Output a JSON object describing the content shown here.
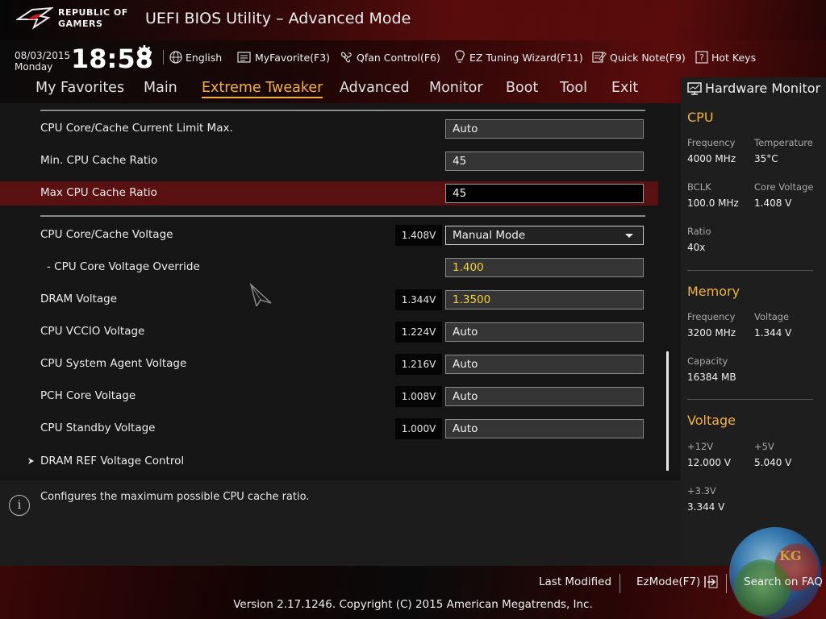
{
  "header": {
    "brand_line1": "REPUBLIC OF",
    "brand_line2": "GAMERS",
    "title": "UEFI BIOS Utility – Advanced Mode",
    "date": "08/03/2015",
    "day": "Monday",
    "time": "18:58"
  },
  "toolbar": {
    "language": "English",
    "my_favorite": "MyFavorite(F3)",
    "qfan": "Qfan Control(F6)",
    "ez_tuning": "EZ Tuning Wizard(F11)",
    "quick_note": "Quick Note(F9)",
    "hot_keys": "Hot Keys"
  },
  "tabs": [
    {
      "label": "My Favorites"
    },
    {
      "label": "Main"
    },
    {
      "label": "Extreme Tweaker",
      "active": true
    },
    {
      "label": "Advanced"
    },
    {
      "label": "Monitor"
    },
    {
      "label": "Boot"
    },
    {
      "label": "Tool"
    },
    {
      "label": "Exit"
    }
  ],
  "settings": [
    {
      "label": "CPU Core/Cache Current Limit Max.",
      "value": "Auto"
    },
    {
      "label": "Min. CPU Cache Ratio",
      "value": "45"
    },
    {
      "label": "Max CPU Cache Ratio",
      "value": "45",
      "selected": true
    },
    {
      "label": "CPU Core/Cache Voltage",
      "reading": "1.408V",
      "value": "Manual Mode",
      "type": "dropdown"
    },
    {
      "label": "- CPU Core Voltage Override",
      "value": "1.400"
    },
    {
      "label": "DRAM Voltage",
      "reading": "1.344V",
      "value": "1.3500"
    },
    {
      "label": "CPU VCCIO Voltage",
      "reading": "1.224V",
      "value": "Auto"
    },
    {
      "label": "CPU System Agent Voltage",
      "reading": "1.216V",
      "value": "Auto"
    },
    {
      "label": "PCH Core Voltage",
      "reading": "1.008V",
      "value": "Auto"
    },
    {
      "label": "CPU Standby Voltage",
      "reading": "1.000V",
      "value": "Auto"
    },
    {
      "label": "DRAM REF Voltage Control",
      "type": "submenu"
    }
  ],
  "info": {
    "icon": "i",
    "text": "Configures the maximum possible CPU cache ratio."
  },
  "hw_monitor": {
    "title": "Hardware Monitor",
    "cpu": {
      "title": "CPU",
      "frequency_label": "Frequency",
      "frequency": "4000 MHz",
      "temperature_label": "Temperature",
      "temperature": "35°C",
      "bclk_label": "BCLK",
      "bclk": "100.0 MHz",
      "core_voltage_label": "Core Voltage",
      "core_voltage": "1.408 V",
      "ratio_label": "Ratio",
      "ratio": "40x"
    },
    "memory": {
      "title": "Memory",
      "frequency_label": "Frequency",
      "frequency": "3200 MHz",
      "voltage_label": "Voltage",
      "voltage": "1.344 V",
      "capacity_label": "Capacity",
      "capacity": "16384 MB"
    },
    "voltage": {
      "title": "Voltage",
      "v12_label": "+12V",
      "v12": "12.000 V",
      "v5_label": "+5V",
      "v5": "5.040 V",
      "v33_label": "+3.3V",
      "v33": "3.344 V"
    }
  },
  "footer": {
    "last_modified": "Last Modified",
    "ez_mode": "EzMode(F7)",
    "search_faq": "Search on FAQ",
    "watermark": "KG",
    "copyright": "Version 2.17.1246. Copyright (C) 2015 American Megatrends, Inc."
  },
  "colors": {
    "accent": "#f3b33a",
    "selected_row": "#5a1111",
    "value_highlight": "#f3d23a"
  }
}
